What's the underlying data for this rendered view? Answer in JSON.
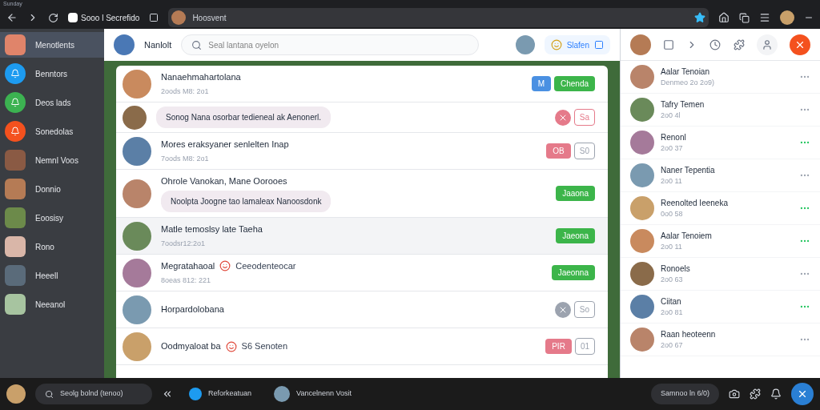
{
  "window": {
    "title": "Sunday"
  },
  "toolbar": {
    "tab_label": "Sooo l Secrefido",
    "address": "Hoosvent"
  },
  "sidebar": {
    "items": [
      {
        "kind": "avatar",
        "label": "Menotlents",
        "color": "#e0846a",
        "selected": true
      },
      {
        "kind": "icon",
        "label": "Benntors",
        "color": "#1d9bf0",
        "selected": false
      },
      {
        "kind": "icon",
        "label": "Deos lads",
        "color": "#3cb251",
        "selected": false
      },
      {
        "kind": "icon",
        "label": "Sonedolas",
        "color": "#f4511e",
        "selected": false
      },
      {
        "kind": "avatar",
        "label": "Nemnl Voos",
        "color": "#8a5a44",
        "selected": false
      },
      {
        "kind": "avatar",
        "label": "Donnio",
        "color": "#b57b55",
        "selected": false
      },
      {
        "kind": "avatar",
        "label": "Eoosisy",
        "color": "#6c8a4a",
        "selected": false
      },
      {
        "kind": "avatar",
        "label": "Rono",
        "color": "#d9b6a8",
        "selected": false
      },
      {
        "kind": "avatar",
        "label": "Heeell",
        "color": "#5a6b7a",
        "selected": false
      },
      {
        "kind": "avatar",
        "label": "Neeanol",
        "color": "#a7c4a0",
        "selected": false
      }
    ]
  },
  "header": {
    "name": "Nanlolt",
    "search": {
      "placeholder": "Seal lantana oyelon"
    },
    "status_button": "Slafen"
  },
  "chat": {
    "rows": [
      {
        "kind": "header",
        "name": "Nanaehmahartolana",
        "time": "2oods M8: 2o1",
        "selected": false,
        "tags": [
          {
            "kind": "solid",
            "color": "#4a90e2",
            "text": "M"
          },
          {
            "kind": "solid",
            "color": "#3cb54a",
            "text": "Chenda"
          }
        ]
      },
      {
        "kind": "bubble",
        "message": "Sonog Nana osorbar tedieneal ak Aenonerl.",
        "selected": false,
        "tags": [
          {
            "kind": "icon",
            "color": "#e57a8a"
          },
          {
            "kind": "outline",
            "color": "#e57a8a",
            "text": "Sa"
          }
        ]
      },
      {
        "kind": "header",
        "name": "Mores eraksyaner senlelten Inap",
        "time": "7oods M8: 2o1",
        "selected": false,
        "tags": [
          {
            "kind": "solid",
            "color": "#e57a8a",
            "text": "OB"
          },
          {
            "kind": "outline",
            "color": "#9ca3af",
            "text": "S0"
          }
        ]
      },
      {
        "kind": "combo",
        "name": "Ohrole Vanokan, Mane Oorooes",
        "message": "Noolpta Joogne tao lamaleax Nanoosdonk",
        "selected": false,
        "tags": [
          {
            "kind": "solid",
            "color": "#3cb54a",
            "text": "Jaaona"
          }
        ]
      },
      {
        "kind": "header",
        "name": "Matle temoslsy late Taeha",
        "time": "7oodsr12:2o1",
        "selected": true,
        "tags": [
          {
            "kind": "solid",
            "color": "#3cb54a",
            "text": "Jaeona"
          }
        ]
      },
      {
        "kind": "header",
        "name": "Megratahaoal",
        "suffix": "Ceeodenteocar",
        "time": "8oeas 812: 221",
        "selected": false,
        "tags": [
          {
            "kind": "solid",
            "color": "#3cb54a",
            "text": "Jaeonna"
          }
        ]
      },
      {
        "kind": "header",
        "name": "Horpardolobana",
        "selected": false,
        "tags": [
          {
            "kind": "icon",
            "color": "#9ca3af"
          },
          {
            "kind": "outline",
            "color": "#9ca3af",
            "text": "So"
          }
        ]
      },
      {
        "kind": "header",
        "name": "Oodmyaloat ba",
        "suffix": "S6 Senoten",
        "selected": false,
        "tags": [
          {
            "kind": "solid",
            "color": "#e57a8a",
            "text": "PIR"
          },
          {
            "kind": "outline",
            "color": "#9ca3af",
            "text": "01"
          }
        ]
      }
    ]
  },
  "contacts": [
    {
      "name": "Aalar Tenoian",
      "sub": "Denmeo 2o 2o9)",
      "online": false
    },
    {
      "name": "Tafry Temen",
      "sub": "2o0 4l",
      "online": false
    },
    {
      "name": "Renonl",
      "sub": "2o0 37",
      "online": true
    },
    {
      "name": "Naner Tepentia",
      "sub": "2o0 11",
      "online": false
    },
    {
      "name": "Reenolted Ieeneka",
      "sub": "0o0 58",
      "online": true
    },
    {
      "name": "Aalar Tenoiem",
      "sub": "2o0 11",
      "online": true
    },
    {
      "name": "Ronoels",
      "sub": "2o0 63",
      "online": false
    },
    {
      "name": "Ciitan",
      "sub": "2o0 81",
      "online": true
    },
    {
      "name": "Raan heoteenn",
      "sub": "2o0 67",
      "online": false
    }
  ],
  "taskbar": {
    "search": "Seolg bolnd (tenoo)",
    "apps": [
      {
        "kind": "icon",
        "label": "Reforkeatuan"
      },
      {
        "kind": "avatar",
        "label": "Vancelnenn Vosit"
      }
    ],
    "status": "Samnoo ln 6/0)"
  }
}
